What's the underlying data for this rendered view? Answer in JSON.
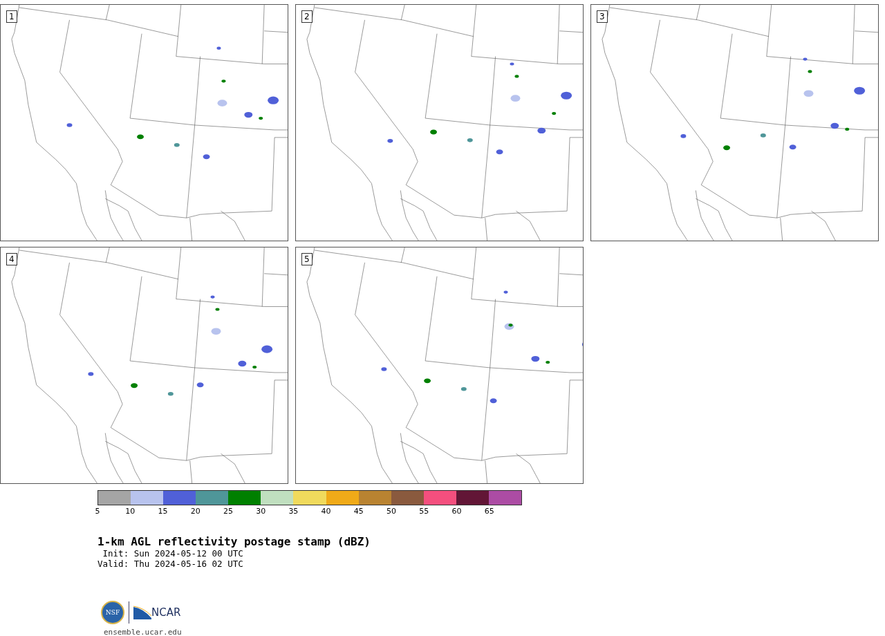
{
  "panels": [
    {
      "label": "1"
    },
    {
      "label": "2"
    },
    {
      "label": "3"
    },
    {
      "label": "4"
    },
    {
      "label": "5"
    }
  ],
  "colorbar": {
    "segments": [
      {
        "color": "#a5a5a5"
      },
      {
        "color": "#b8c3ee"
      },
      {
        "color": "#5060d8"
      },
      {
        "color": "#4f9699"
      },
      {
        "color": "#008000"
      },
      {
        "color": "#c0dfbf"
      },
      {
        "color": "#f0da5c"
      },
      {
        "color": "#f0aa18"
      },
      {
        "color": "#b98331"
      },
      {
        "color": "#8a5a3e"
      },
      {
        "color": "#f44f7e"
      },
      {
        "color": "#621636"
      },
      {
        "color": "#ac4ca4"
      }
    ],
    "ticks": [
      "5",
      "10",
      "15",
      "20",
      "25",
      "30",
      "35",
      "40",
      "45",
      "50",
      "55",
      "60",
      "65"
    ]
  },
  "title": "1-km AGL reflectivity postage stamp (dBZ)",
  "init": " Init: Sun 2024-05-12 00 UTC",
  "valid": "Valid: Thu 2024-05-16 02 UTC",
  "logo": {
    "nsf": "NSF",
    "ncar": "NCAR"
  },
  "footer": "ensemble.ucar.edu"
}
